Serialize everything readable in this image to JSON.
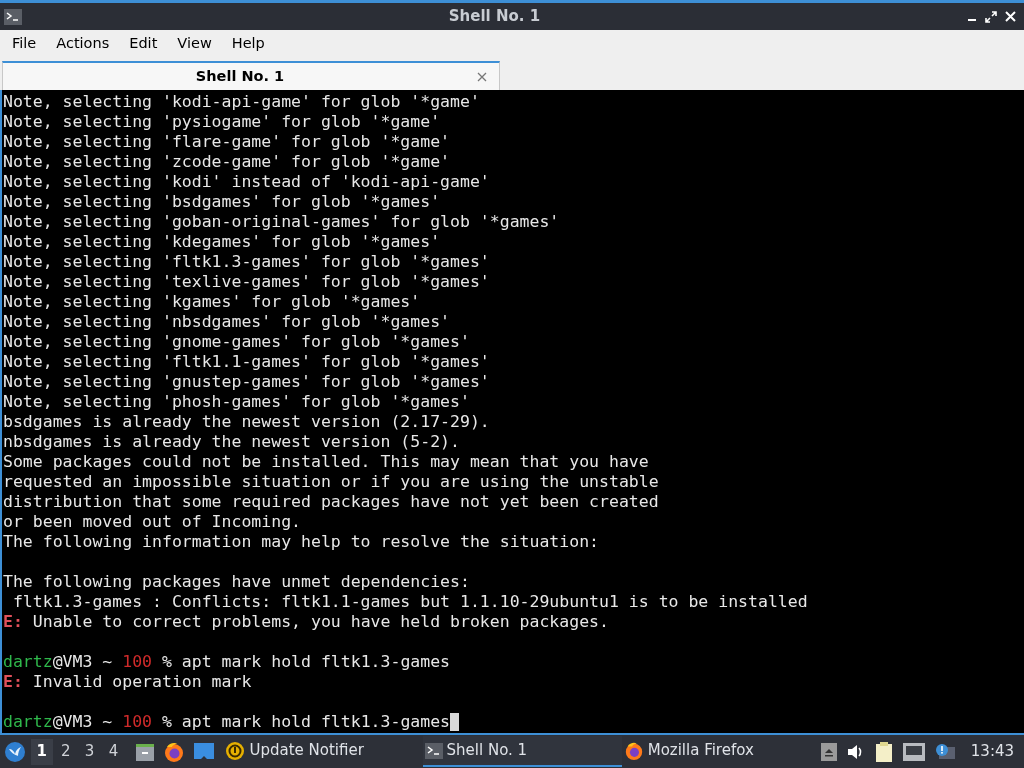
{
  "window": {
    "title": "Shell No. 1"
  },
  "menu": [
    "File",
    "Actions",
    "Edit",
    "View",
    "Help"
  ],
  "tabs": [
    {
      "label": "Shell No. 1",
      "selected": true
    }
  ],
  "terminal": {
    "lines": [
      {
        "kind": "text",
        "parts": [
          {
            "kind": "plain",
            "text": "Note, selecting 'kodi-api-game' for glob '*game'"
          }
        ]
      },
      {
        "kind": "text",
        "parts": [
          {
            "kind": "plain",
            "text": "Note, selecting 'pysiogame' for glob '*game'"
          }
        ]
      },
      {
        "kind": "text",
        "parts": [
          {
            "kind": "plain",
            "text": "Note, selecting 'flare-game' for glob '*game'"
          }
        ]
      },
      {
        "kind": "text",
        "parts": [
          {
            "kind": "plain",
            "text": "Note, selecting 'zcode-game' for glob '*game'"
          }
        ]
      },
      {
        "kind": "text",
        "parts": [
          {
            "kind": "plain",
            "text": "Note, selecting 'kodi' instead of 'kodi-api-game'"
          }
        ]
      },
      {
        "kind": "text",
        "parts": [
          {
            "kind": "plain",
            "text": "Note, selecting 'bsdgames' for glob '*games'"
          }
        ]
      },
      {
        "kind": "text",
        "parts": [
          {
            "kind": "plain",
            "text": "Note, selecting 'goban-original-games' for glob '*games'"
          }
        ]
      },
      {
        "kind": "text",
        "parts": [
          {
            "kind": "plain",
            "text": "Note, selecting 'kdegames' for glob '*games'"
          }
        ]
      },
      {
        "kind": "text",
        "parts": [
          {
            "kind": "plain",
            "text": "Note, selecting 'fltk1.3-games' for glob '*games'"
          }
        ]
      },
      {
        "kind": "text",
        "parts": [
          {
            "kind": "plain",
            "text": "Note, selecting 'texlive-games' for glob '*games'"
          }
        ]
      },
      {
        "kind": "text",
        "parts": [
          {
            "kind": "plain",
            "text": "Note, selecting 'kgames' for glob '*games'"
          }
        ]
      },
      {
        "kind": "text",
        "parts": [
          {
            "kind": "plain",
            "text": "Note, selecting 'nbsdgames' for glob '*games'"
          }
        ]
      },
      {
        "kind": "text",
        "parts": [
          {
            "kind": "plain",
            "text": "Note, selecting 'gnome-games' for glob '*games'"
          }
        ]
      },
      {
        "kind": "text",
        "parts": [
          {
            "kind": "plain",
            "text": "Note, selecting 'fltk1.1-games' for glob '*games'"
          }
        ]
      },
      {
        "kind": "text",
        "parts": [
          {
            "kind": "plain",
            "text": "Note, selecting 'gnustep-games' for glob '*games'"
          }
        ]
      },
      {
        "kind": "text",
        "parts": [
          {
            "kind": "plain",
            "text": "Note, selecting 'phosh-games' for glob '*games'"
          }
        ]
      },
      {
        "kind": "text",
        "parts": [
          {
            "kind": "plain",
            "text": "bsdgames is already the newest version (2.17-29)."
          }
        ]
      },
      {
        "kind": "text",
        "parts": [
          {
            "kind": "plain",
            "text": "nbsdgames is already the newest version (5-2)."
          }
        ]
      },
      {
        "kind": "text",
        "parts": [
          {
            "kind": "plain",
            "text": "Some packages could not be installed. This may mean that you have"
          }
        ]
      },
      {
        "kind": "text",
        "parts": [
          {
            "kind": "plain",
            "text": "requested an impossible situation or if you are using the unstable"
          }
        ]
      },
      {
        "kind": "text",
        "parts": [
          {
            "kind": "plain",
            "text": "distribution that some required packages have not yet been created"
          }
        ]
      },
      {
        "kind": "text",
        "parts": [
          {
            "kind": "plain",
            "text": "or been moved out of Incoming."
          }
        ]
      },
      {
        "kind": "text",
        "parts": [
          {
            "kind": "plain",
            "text": "The following information may help to resolve the situation:"
          }
        ]
      },
      {
        "kind": "blank"
      },
      {
        "kind": "text",
        "parts": [
          {
            "kind": "plain",
            "text": "The following packages have unmet dependencies:"
          }
        ]
      },
      {
        "kind": "text",
        "parts": [
          {
            "kind": "plain",
            "text": " fltk1.3-games : Conflicts: fltk1.1-games but 1.1.10-29ubuntu1 is to be installed"
          }
        ]
      },
      {
        "kind": "text",
        "parts": [
          {
            "kind": "error",
            "text": "E:"
          },
          {
            "kind": "plain",
            "text": " Unable to correct problems, you have held broken packages."
          }
        ]
      },
      {
        "kind": "blank"
      },
      {
        "kind": "text",
        "parts": [
          {
            "kind": "user",
            "text": "dartz"
          },
          {
            "kind": "plain",
            "text": "@VM3 ~ "
          },
          {
            "kind": "number",
            "text": "100"
          },
          {
            "kind": "plain",
            "text": " % apt mark hold fltk1.3-games"
          }
        ]
      },
      {
        "kind": "text",
        "parts": [
          {
            "kind": "error",
            "text": "E:"
          },
          {
            "kind": "plain",
            "text": " Invalid operation mark"
          }
        ]
      },
      {
        "kind": "blank"
      },
      {
        "kind": "text",
        "cursor": true,
        "parts": [
          {
            "kind": "user",
            "text": "dartz"
          },
          {
            "kind": "plain",
            "text": "@VM3 ~ "
          },
          {
            "kind": "number",
            "text": "100"
          },
          {
            "kind": "plain",
            "text": " % apt mark hold fltk1.3-games"
          }
        ]
      }
    ]
  },
  "taskbar": {
    "desktops": [
      {
        "label": "1",
        "selected": true
      },
      {
        "label": "2",
        "selected": false
      },
      {
        "label": "3",
        "selected": false
      },
      {
        "label": "4",
        "selected": false
      }
    ],
    "tasks": [
      {
        "kind": "notifier",
        "label": "Update Notifier",
        "selected": false
      },
      {
        "kind": "terminal",
        "label": "Shell No. 1",
        "selected": true
      },
      {
        "kind": "firefox",
        "label": "Mozilla Firefox",
        "selected": false
      }
    ],
    "clock": "13:43"
  }
}
